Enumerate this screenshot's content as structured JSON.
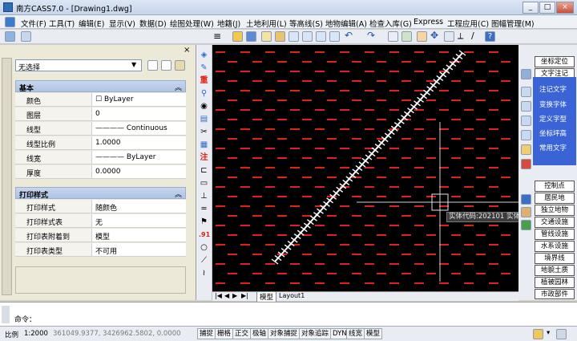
{
  "window": {
    "title": "南方CASS7.0 - [Drawing1.dwg]",
    "min": "_",
    "max": "□",
    "close": "×"
  },
  "menu": [
    "文件(F)",
    "工具(T)",
    "编辑(E)",
    "显示(V)",
    "数据(D)",
    "绘图处理(W)",
    "地籍(J)",
    "土地利用(L)",
    "等高线(S)",
    "地物编辑(A)",
    "检查入库(G)",
    "Express",
    "工程应用(C)",
    "图幅管理(M)"
  ],
  "layer": {
    "current": "0"
  },
  "properties": {
    "selection": "无选择",
    "basic_title": "基本",
    "basic": [
      {
        "key": "颜色",
        "value": "ByLayer"
      },
      {
        "key": "图层",
        "value": "0"
      },
      {
        "key": "线型",
        "value": "Continuous"
      },
      {
        "key": "线型比例",
        "value": "1.0000"
      },
      {
        "key": "线宽",
        "value": "ByLayer"
      },
      {
        "key": "厚度",
        "value": "0.0000"
      }
    ],
    "print_title": "打印样式",
    "print": [
      {
        "key": "打印样式",
        "value": "随颜色"
      },
      {
        "key": "打印样式表",
        "value": "无"
      },
      {
        "key": "打印表附着到",
        "value": "模型"
      },
      {
        "key": "打印表类型",
        "value": "不可用"
      }
    ]
  },
  "tooltip": "实体代码:202101 实体名称:一般高程点",
  "tabs": {
    "model": "模型",
    "layout": "Layout1"
  },
  "right_panel": {
    "buttons_top": [
      "坐标定位",
      "文字注记"
    ],
    "links": [
      "注记文字",
      "变换字体",
      "定义字型",
      "坐标坪高",
      "常用文字"
    ],
    "buttons_bottom": [
      "控制点",
      "居民地",
      "独立地物",
      "交通设施",
      "管线设施",
      "水系设施",
      "境界线",
      "地貌土质",
      "植被园林",
      "市政部件"
    ]
  },
  "command": {
    "prompt": "命令："
  },
  "status": {
    "scale_label": "比例",
    "scale": "1:2000",
    "coords": "361049.9377, 3426962.5802, 0.0000",
    "toggles": [
      "捕捉",
      "栅格",
      "正交",
      "极轴",
      "对象捕捉",
      "对象追踪",
      "DYN",
      "线宽",
      "模型"
    ]
  }
}
